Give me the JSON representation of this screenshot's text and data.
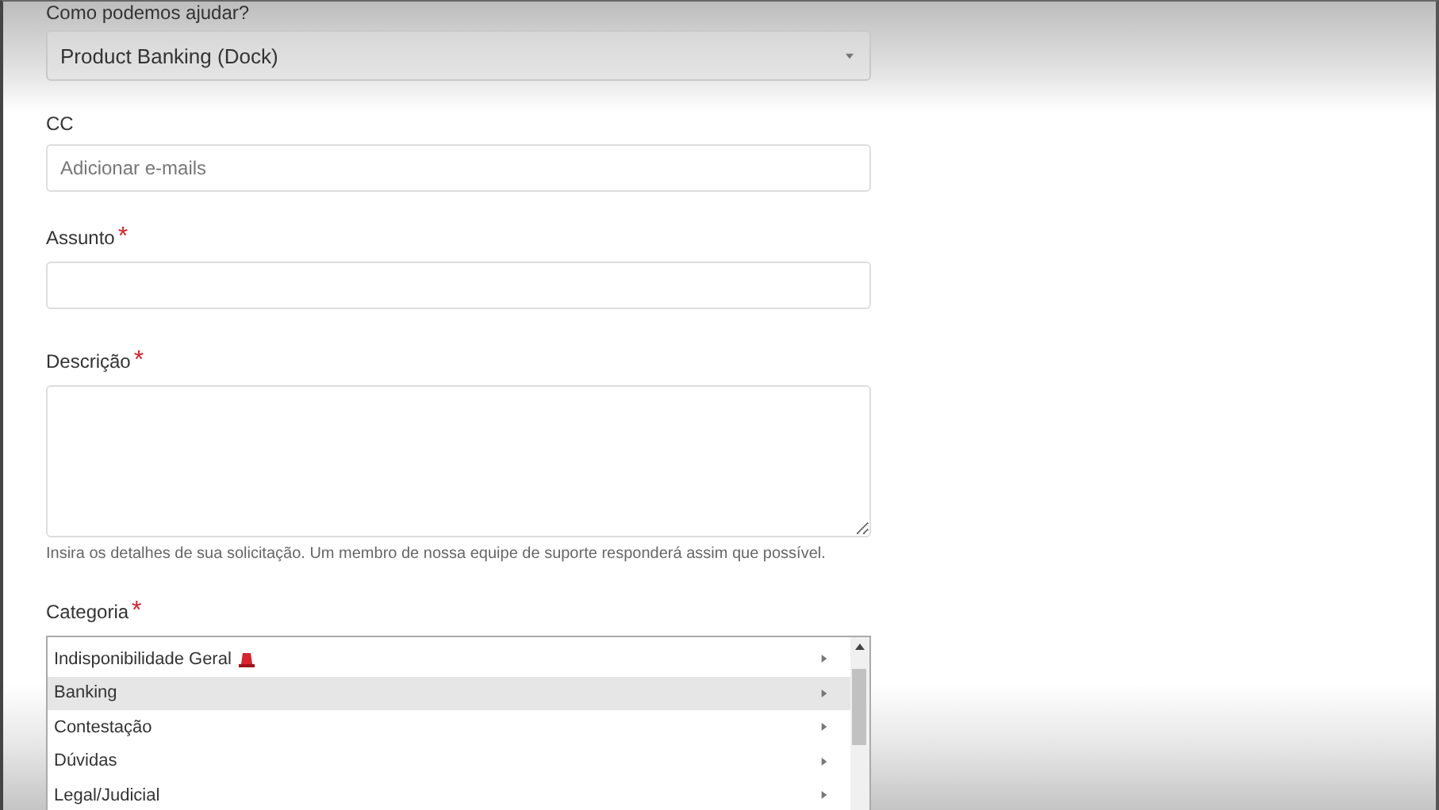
{
  "form": {
    "help_select": {
      "label": "Como podemos ajudar?",
      "value": "Product Banking (Dock)"
    },
    "cc": {
      "label": "CC",
      "placeholder": "Adicionar e-mails"
    },
    "subject": {
      "label": "Assunto",
      "required_mark": "*"
    },
    "description": {
      "label": "Descrição",
      "required_mark": "*",
      "hint": "Insira os detalhes de sua solicitação. Um membro de nossa equipe de suporte responderá assim que possível."
    },
    "category": {
      "label": "Categoria",
      "required_mark": "*",
      "options": [
        {
          "label": "Indisponibilidade Geral",
          "kind": "alert",
          "selected": false
        },
        {
          "label": "Banking",
          "kind": "plain",
          "selected": true
        },
        {
          "label": "Contestação",
          "kind": "plain",
          "selected": false
        },
        {
          "label": "Dúvidas",
          "kind": "plain",
          "selected": false
        },
        {
          "label": "Legal/Judicial",
          "kind": "plain",
          "selected": false
        }
      ]
    }
  }
}
